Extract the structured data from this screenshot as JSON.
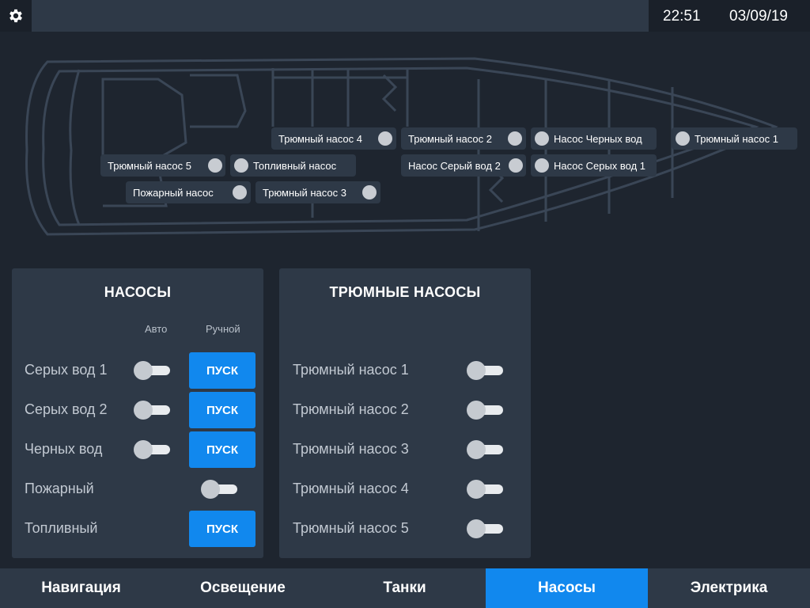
{
  "header": {
    "time": "22:51",
    "date": "03/09/19",
    "settings_icon": "gear-icon"
  },
  "map_pumps": [
    {
      "label": "Трюмный насос 4",
      "dot_side": "right"
    },
    {
      "label": "Трюмный насос 2",
      "dot_side": "right"
    },
    {
      "label": "Насос Черных вод",
      "dot_side": "left"
    },
    {
      "label": "Трюмный насос 1",
      "dot_side": "left"
    },
    {
      "label": "Трюмный насос 5",
      "dot_side": "right"
    },
    {
      "label": "Топливный насос",
      "dot_side": "left"
    },
    {
      "label": "Насос Серый вод 2",
      "dot_side": "right"
    },
    {
      "label": "Насос Серых вод 1",
      "dot_side": "left"
    },
    {
      "label": "Пожарный насос",
      "dot_side": "right"
    },
    {
      "label": "Трюмный насос 3",
      "dot_side": "right"
    }
  ],
  "pumps_panel": {
    "title": "НАСОСЫ",
    "col_auto": "Авто",
    "col_manual": "Ручной",
    "rows": [
      {
        "label": "Серых вод 1",
        "auto_on": false,
        "start_label": "ПУСК"
      },
      {
        "label": "Серых вод 2",
        "auto_on": false,
        "start_label": "ПУСК"
      },
      {
        "label": "Черных вод",
        "auto_on": false,
        "start_label": "ПУСК"
      },
      {
        "label": "Пожарный",
        "manual_toggle_on": false
      },
      {
        "label": "Топливный",
        "start_label": "ПУСК"
      }
    ]
  },
  "bilge_panel": {
    "title": "ТРЮМНЫЕ НАСОСЫ",
    "rows": [
      {
        "label": "Трюмный насос 1",
        "on": false
      },
      {
        "label": "Трюмный насос 2",
        "on": false
      },
      {
        "label": "Трюмный насос 3",
        "on": false
      },
      {
        "label": "Трюмный насос 4",
        "on": false
      },
      {
        "label": "Трюмный насос 5",
        "on": false
      }
    ]
  },
  "nav": {
    "tabs": [
      {
        "label": "Навигация",
        "active": false
      },
      {
        "label": "Освещение",
        "active": false
      },
      {
        "label": "Танки",
        "active": false
      },
      {
        "label": "Насосы",
        "active": true
      },
      {
        "label": "Электрика",
        "active": false
      }
    ]
  },
  "colors": {
    "accent": "#1188ee",
    "panel": "#2e3947",
    "background": "#1e252f"
  }
}
